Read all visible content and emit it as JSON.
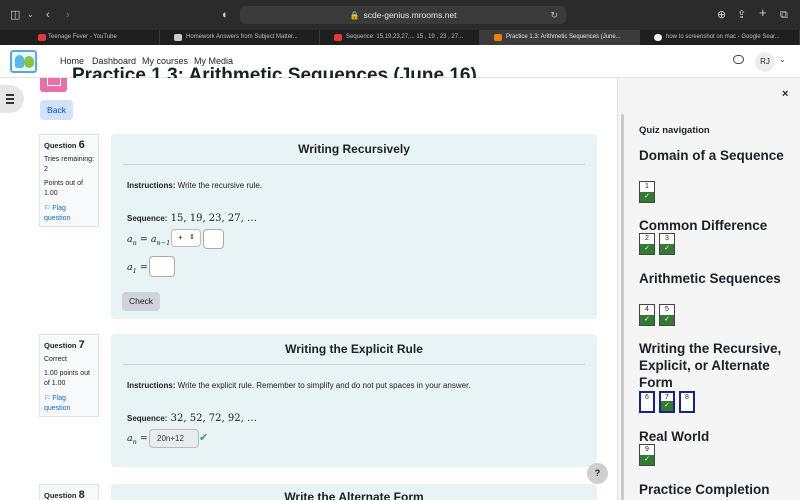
{
  "browser": {
    "url": "scde-genius.mrooms.net",
    "tabs": [
      {
        "label": "Teenage Fever - YouTube",
        "color": "#e53935"
      },
      {
        "label": "Homework Answers from Subject Matter...",
        "color": "#cccccc"
      },
      {
        "label": "Sequence: 15,19,23,27,... 15 , 19 , 23 , 27...",
        "color": "#e53935"
      },
      {
        "label": "Practice 1.3: Arithmetic Sequences (June...",
        "color": "#f57c00"
      },
      {
        "label": "how to screenshot on mac - Google Sear...",
        "color": "#eeeeee"
      }
    ]
  },
  "site": {
    "nav": [
      "Home",
      "Dashboard",
      "My courses",
      "My Media"
    ],
    "user_initials": "RJ"
  },
  "page": {
    "heading": "Practice 1.3: Arithmetic Sequences (June 16)",
    "back_label": "Back",
    "help_label": "?"
  },
  "q6": {
    "label": "Question",
    "number": "6",
    "tries": "Tries remaining: 2",
    "points": "Points out of 1.00",
    "flag": "Flag question",
    "title": "Writing Recursively",
    "instructions_label": "Instructions:",
    "instructions": " Write the recursive rule.",
    "sequence_label": "Sequence:",
    "sequence": " 15, 19, 23, 27, …",
    "rule_lhs": "a",
    "rule_lhs_sub": "n",
    "rule_rhs": "a",
    "rule_rhs_sub": "n−1",
    "operator": "+",
    "first_term": "a",
    "first_term_sub": "1",
    "check_label": "Check"
  },
  "q7": {
    "label": "Question",
    "number": "7",
    "status": "Correct",
    "points": "1.00 points out of 1.00",
    "flag": "Flag question",
    "title": "Writing the Explicit Rule",
    "instructions_label": "Instructions:",
    "instructions": " Write the explicit rule. Remember to simplify and do not put spaces in your answer.",
    "sequence_label": "Sequence:",
    "sequence": " 32, 52, 72, 92, …",
    "lhs": "a",
    "lhs_sub": "n",
    "answer": "20n+12"
  },
  "q8": {
    "label": "Question",
    "number": "8",
    "title": "Write the Alternate Form"
  },
  "quiz_nav": {
    "title": "Quiz navigation",
    "close": "×",
    "sections": [
      {
        "name": "Domain of a Sequence",
        "questions": [
          {
            "n": "1",
            "done": true
          }
        ]
      },
      {
        "name": "Common Difference",
        "questions": [
          {
            "n": "2",
            "done": true
          },
          {
            "n": "3",
            "done": true
          }
        ]
      },
      {
        "name": "Arithmetic Sequences",
        "questions": [
          {
            "n": "4",
            "done": true
          },
          {
            "n": "5",
            "done": true
          }
        ]
      },
      {
        "name": "Writing the Recursive, Explicit, or Alternate Form",
        "questions": [
          {
            "n": "6",
            "done": false
          },
          {
            "n": "7",
            "done": true
          },
          {
            "n": "8",
            "done": false
          }
        ]
      },
      {
        "name": "Real World",
        "questions": [
          {
            "n": "9",
            "done": true
          }
        ]
      },
      {
        "name": "Practice Completion",
        "questions": []
      }
    ]
  }
}
